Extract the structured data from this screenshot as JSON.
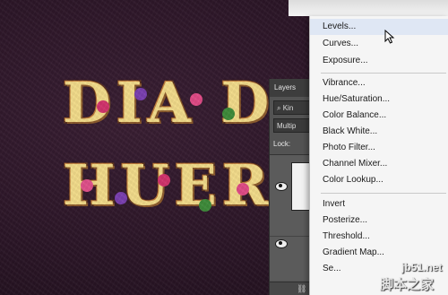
{
  "canvas": {
    "line1": "DIA DE",
    "line2": "HUERT"
  },
  "layers_panel": {
    "tab_label": "Layers",
    "search_value": "Kin",
    "blend_mode": "Multip",
    "lock_label": "Lock:",
    "footer_label": "fx"
  },
  "menu": {
    "items": [
      {
        "label": "Levels..."
      },
      {
        "label": "Curves..."
      },
      {
        "label": "Exposure..."
      },
      {
        "label": "Vibrance..."
      },
      {
        "label": "Hue/Saturation..."
      },
      {
        "label": "Color Balance..."
      },
      {
        "label": "Black  White..."
      },
      {
        "label": "Photo Filter..."
      },
      {
        "label": "Channel Mixer..."
      },
      {
        "label": "Color Lookup..."
      },
      {
        "label": "Invert"
      },
      {
        "label": "Posterize..."
      },
      {
        "label": "Threshold..."
      },
      {
        "label": "Gradient Map..."
      },
      {
        "label": "Se..."
      }
    ]
  },
  "watermark": {
    "site": "jb51.net",
    "name": "脚本之家"
  },
  "colors": {
    "menu_bg": "#f5f5f5",
    "panel_bg": "#535353",
    "letter_fill": "#f3dc8a"
  }
}
